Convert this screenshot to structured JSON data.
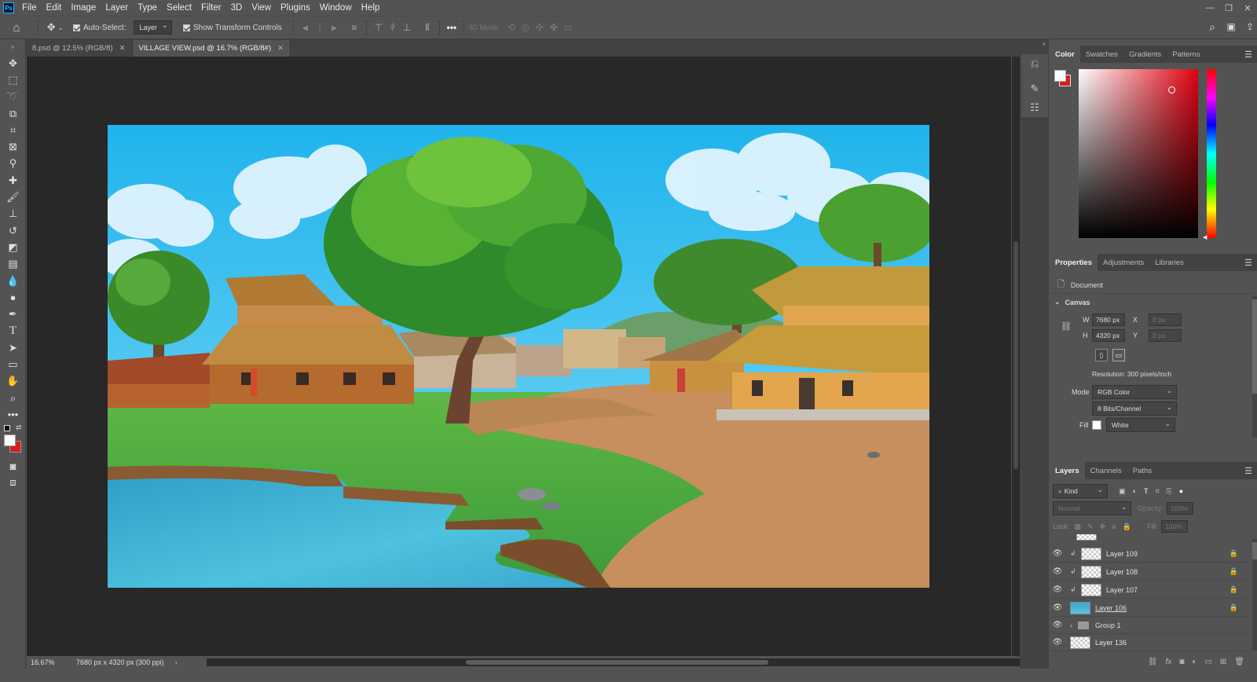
{
  "menubar": {
    "logo": "Ps",
    "items": [
      "File",
      "Edit",
      "Image",
      "Layer",
      "Type",
      "Select",
      "Filter",
      "3D",
      "View",
      "Plugins",
      "Window",
      "Help"
    ],
    "window_controls": [
      "—",
      "❐",
      "✕"
    ]
  },
  "options": {
    "auto_select_label": "Auto-Select:",
    "auto_select_value": "Layer",
    "show_transform_label": "Show Transform Controls",
    "mode_3d_label": "3D Mode:"
  },
  "tabs": [
    {
      "label": "8.psd @ 12.5% (RGB/8)",
      "active": false
    },
    {
      "label": "VILLAGE VIEW.psd @ 16.7% (RGB/8#)",
      "active": true
    }
  ],
  "status": {
    "zoom": "16.67%",
    "doc_info": "7680 px x 4320 px (300 ppi)"
  },
  "color_panel": {
    "tabs": [
      "Color",
      "Swatches",
      "Gradients",
      "Patterns"
    ],
    "foreground": "#ffffff",
    "background": "#d42020"
  },
  "properties": {
    "tabs": [
      "Properties",
      "Adjustments",
      "Libraries"
    ],
    "doc_label": "Document",
    "section": "Canvas",
    "w_label": "W",
    "w_value": "7680 px",
    "h_label": "H",
    "h_value": "4320 px",
    "x_label": "X",
    "x_value": "0 px",
    "y_label": "Y",
    "y_value": "0 px",
    "resolution": "Resolution: 300 pixels/inch",
    "mode_label": "Mode",
    "mode_value": "RGB Color",
    "bits_value": "8 Bits/Channel",
    "fill_label": "Fill",
    "fill_value": "White"
  },
  "layers_panel": {
    "tabs": [
      "Layers",
      "Channels",
      "Paths"
    ],
    "kind_label": "Kind",
    "blend_mode": "Normal",
    "opacity_label": "Opacity:",
    "opacity_value": "100%",
    "lock_label": "Lock:",
    "fill_label": "Fill:",
    "fill_value": "100%",
    "layers": [
      {
        "name": "Layer 109",
        "clipped": true,
        "locked": true
      },
      {
        "name": "Layer 108",
        "clipped": true,
        "locked": true
      },
      {
        "name": "Layer 107",
        "clipped": true,
        "locked": true
      },
      {
        "name": "Layer 106",
        "clipped": false,
        "locked": true
      },
      {
        "name": "Group 1",
        "clipped": false,
        "locked": false
      },
      {
        "name": "Layer 136",
        "clipped": false,
        "locked": false
      }
    ]
  }
}
